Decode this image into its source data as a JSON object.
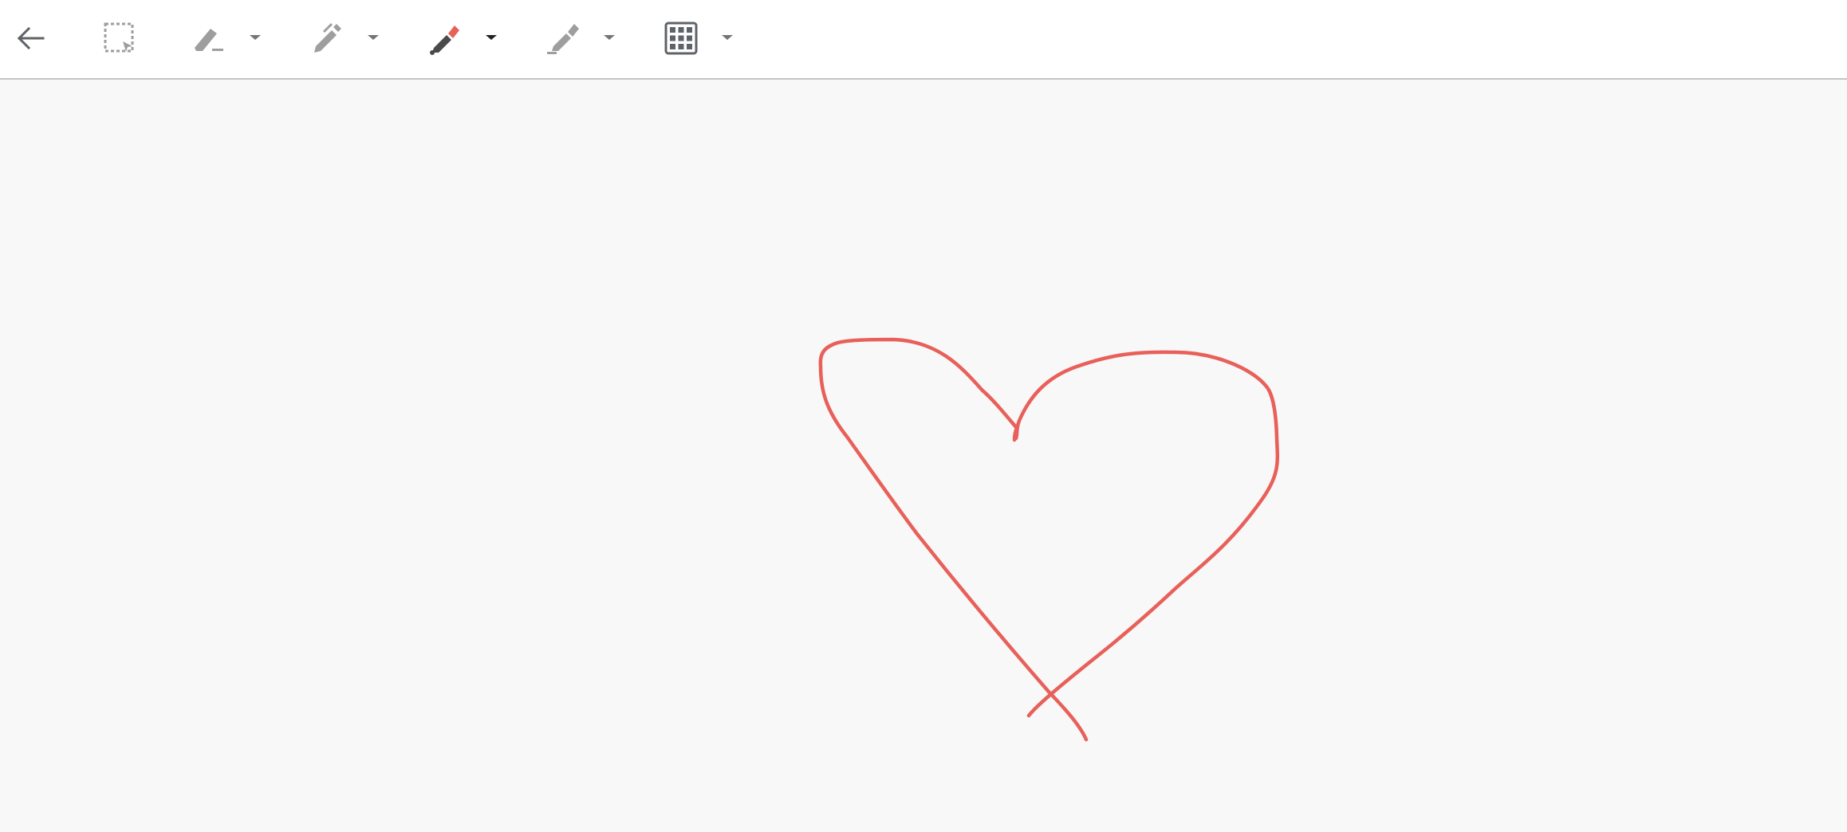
{
  "toolbar": {
    "tools": [
      {
        "name": "back",
        "icon": "arrow-back-icon"
      },
      {
        "name": "select",
        "icon": "lasso-select-icon"
      },
      {
        "name": "eraser",
        "icon": "eraser-icon",
        "has_menu": true
      },
      {
        "name": "pen",
        "icon": "pen-icon",
        "has_menu": true
      },
      {
        "name": "marker",
        "icon": "marker-icon",
        "has_menu": true,
        "active": true
      },
      {
        "name": "highlighter",
        "icon": "highlighter-icon",
        "has_menu": true
      },
      {
        "name": "background",
        "icon": "grid-icon",
        "has_menu": true
      }
    ]
  },
  "canvas": {
    "stroke_color": "#e8605a",
    "stroke_description": "heart"
  },
  "colors": {
    "icon_gray": "#9e9e9e",
    "icon_dark": "#5f6368",
    "accent": "#e8605a"
  }
}
